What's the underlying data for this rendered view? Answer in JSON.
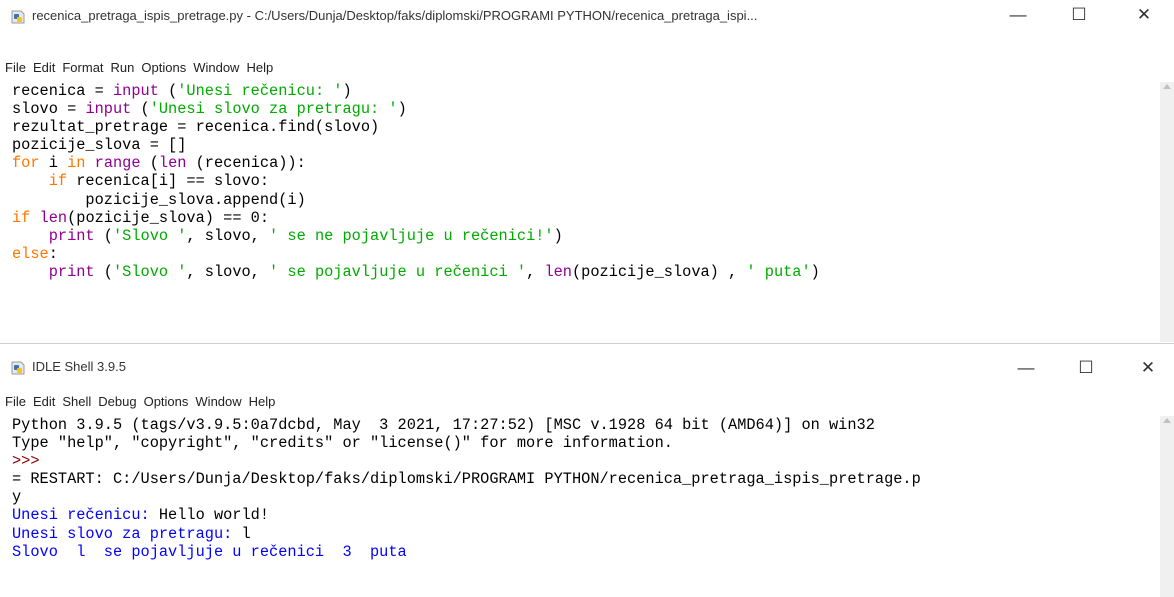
{
  "editor": {
    "title": "recenica_pretraga_ispis_pretrage.py - C:/Users/Dunja/Desktop/faks/diplomski/PROGRAMI PYTHON/recenica_pretraga_ispi...",
    "menu": [
      "File",
      "Edit",
      "Format",
      "Run",
      "Options",
      "Window",
      "Help"
    ],
    "lines": [
      [
        {
          "t": "recenica = "
        },
        {
          "t": "input",
          "c": "bi"
        },
        {
          "t": " ("
        },
        {
          "t": "'Unesi rečenicu: '",
          "c": "str"
        },
        {
          "t": ")"
        }
      ],
      [
        {
          "t": "slovo = "
        },
        {
          "t": "input",
          "c": "bi"
        },
        {
          "t": " ("
        },
        {
          "t": "'Unesi slovo za pretragu: '",
          "c": "str"
        },
        {
          "t": ")"
        }
      ],
      [
        {
          "t": "rezultat_pretrage = recenica.find(slovo)"
        }
      ],
      [
        {
          "t": "pozicije_slova = []"
        }
      ],
      [
        {
          "t": "for",
          "c": "kw"
        },
        {
          "t": " i "
        },
        {
          "t": "in",
          "c": "kw"
        },
        {
          "t": " "
        },
        {
          "t": "range",
          "c": "bi"
        },
        {
          "t": " ("
        },
        {
          "t": "len",
          "c": "bi"
        },
        {
          "t": " (recenica)):"
        }
      ],
      [
        {
          "t": "    "
        },
        {
          "t": "if",
          "c": "kw"
        },
        {
          "t": " recenica[i] == slovo:"
        }
      ],
      [
        {
          "t": "        pozicije_slova.append(i)"
        }
      ],
      [
        {
          "t": "if",
          "c": "kw"
        },
        {
          "t": " "
        },
        {
          "t": "len",
          "c": "bi"
        },
        {
          "t": "(pozicije_slova) == 0:"
        }
      ],
      [
        {
          "t": "    "
        },
        {
          "t": "print",
          "c": "bi"
        },
        {
          "t": " ("
        },
        {
          "t": "'Slovo '",
          "c": "str"
        },
        {
          "t": ", slovo, "
        },
        {
          "t": "' se ne pojavljuje u rečenici!'",
          "c": "str"
        },
        {
          "t": ")"
        }
      ],
      [
        {
          "t": "else",
          "c": "kw"
        },
        {
          "t": ":"
        }
      ],
      [
        {
          "t": "    "
        },
        {
          "t": "print",
          "c": "bi"
        },
        {
          "t": " ("
        },
        {
          "t": "'Slovo '",
          "c": "str"
        },
        {
          "t": ", slovo, "
        },
        {
          "t": "' se pojavljuje u rečenici '",
          "c": "str"
        },
        {
          "t": ", "
        },
        {
          "t": "len",
          "c": "bi"
        },
        {
          "t": "(pozicije_slova) , "
        },
        {
          "t": "' puta'",
          "c": "str"
        },
        {
          "t": ")"
        }
      ]
    ]
  },
  "shell": {
    "title": "IDLE Shell 3.9.5",
    "menu": [
      "File",
      "Edit",
      "Shell",
      "Debug",
      "Options",
      "Window",
      "Help"
    ],
    "lines": [
      [
        {
          "t": "Python 3.9.5 (tags/v3.9.5:0a7dcbd, May  3 2021, 17:27:52) [MSC v.1928 64 bit (AMD64)] on win32"
        }
      ],
      [
        {
          "t": "Type \"help\", \"copyright\", \"credits\" or \"license()\" for more information."
        }
      ],
      [
        {
          "t": ">>>",
          "c": "prompt"
        }
      ],
      [
        {
          "t": "= RESTART: C:/Users/Dunja/Desktop/faks/diplomski/PROGRAMI PYTHON/recenica_pretraga_ispis_pretrage.p"
        }
      ],
      [
        {
          "t": "y"
        }
      ],
      [
        {
          "t": "Unesi rečenicu: ",
          "c": "out"
        },
        {
          "t": "Hello world!"
        }
      ],
      [
        {
          "t": "Unesi slovo za pretragu: ",
          "c": "out"
        },
        {
          "t": "l"
        }
      ],
      [
        {
          "t": "Slovo  l  se pojavljuje u rečenici  3  puta",
          "c": "out"
        }
      ]
    ]
  },
  "window_controls": {
    "minimize": "—",
    "maximize": "☐",
    "close": "✕"
  },
  "colors": {
    "keyword": "#ff7700",
    "builtin": "#900090",
    "string": "#00aa00",
    "output": "#0000ff",
    "prompt": "#8b0000"
  }
}
